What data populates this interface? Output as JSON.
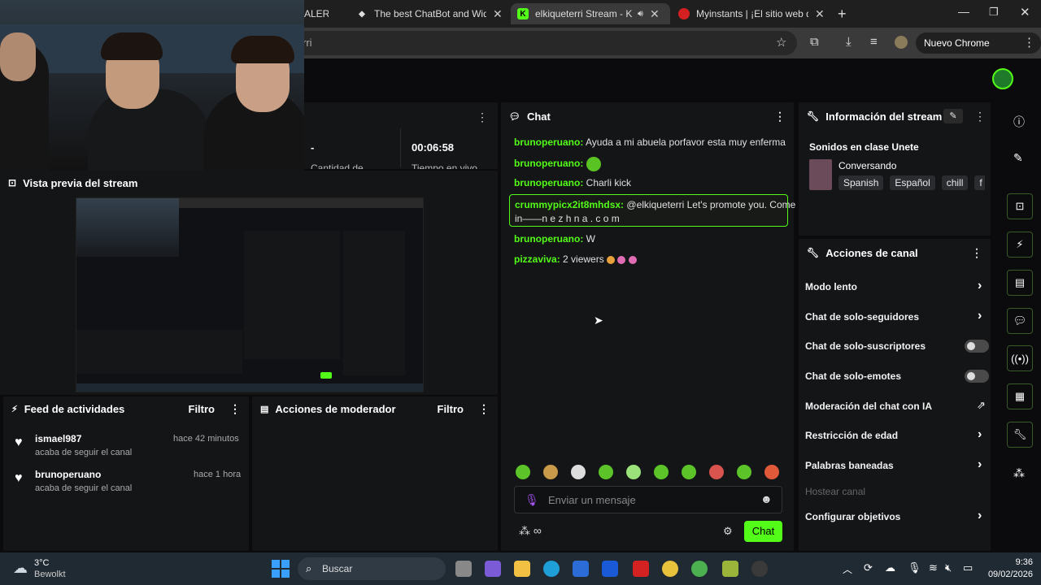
{
  "browser": {
    "tabs": [
      {
        "title": "ALER",
        "close": "✕"
      },
      {
        "title": "The best ChatBot and Widgets",
        "close": "✕"
      },
      {
        "title": "elkiqueterri Stream - Kick D",
        "close": "✕"
      },
      {
        "title": "Myinstants | ¡El sitio web de bo",
        "close": "✕"
      }
    ],
    "new_tab": "+",
    "omnibox_value": "rri",
    "update_badge": "Nuevo Chrome disponible"
  },
  "colors": {
    "accent": "#53fc18",
    "panel": "#141517",
    "bg": "#0b0b0d"
  },
  "stream_stats": {
    "dash": "-",
    "timer": "00:06:58",
    "label_left": "Cantidad de",
    "label_right": "Tiempo en vivo"
  },
  "preview": {
    "title": "Vista previa del stream"
  },
  "activity": {
    "title": "Feed de actividades",
    "filter": "Filtro",
    "items": [
      {
        "user": "ismael987",
        "time": "hace 42 minutos",
        "action": "acaba de seguir el canal"
      },
      {
        "user": "brunoperuano",
        "time": "hace 1 hora",
        "action": "acaba de seguir el canal"
      }
    ]
  },
  "moderator": {
    "title": "Acciones de moderador",
    "filter": "Filtro"
  },
  "chat": {
    "title": "Chat",
    "messages": [
      {
        "user": "brunoperuano:",
        "text": "Ayuda a mi abuela porfavor esta muy enferma"
      },
      {
        "user": "brunoperuano:",
        "text": ""
      },
      {
        "user": "brunoperuano:",
        "text": "Charli kick"
      },
      {
        "user": "crummypicx2it8mhdsx:",
        "text": "@elkiqueterri Let's promote you. Come",
        "text2": "in——n e z h n a . c  o m"
      },
      {
        "user": "brunoperuano:",
        "text": "W"
      },
      {
        "user": "pizzaviva:",
        "text": "2 viewers"
      }
    ],
    "input_placeholder": "Enviar un mensaje",
    "send_label": "Chat"
  },
  "stream_info": {
    "title": "Información del stream",
    "stream_title": "Sonidos en clase Unete",
    "category": "Conversando",
    "tags": [
      "Spanish",
      "Español",
      "chill",
      "f"
    ]
  },
  "channel_actions": {
    "title": "Acciones de canal",
    "items": [
      {
        "label": "Modo lento",
        "control": "chevron"
      },
      {
        "label": "Chat de solo-seguidores",
        "control": "chevron"
      },
      {
        "label": "Chat de solo-suscriptores",
        "control": "toggle"
      },
      {
        "label": "Chat de solo-emotes",
        "control": "toggle"
      },
      {
        "label": "Moderación del chat con IA",
        "control": "external"
      },
      {
        "label": "Restricción de edad",
        "control": "chevron"
      },
      {
        "label": "Palabras baneadas",
        "control": "chevron"
      },
      {
        "label": "Hostear canal",
        "control": "none"
      },
      {
        "label": "Configurar objetivos",
        "control": "chevron"
      }
    ]
  },
  "taskbar": {
    "weather_temp": "3°C",
    "weather_desc": "Bewolkt",
    "search": "Buscar",
    "time": "9:36",
    "date": "09/02/2026"
  }
}
